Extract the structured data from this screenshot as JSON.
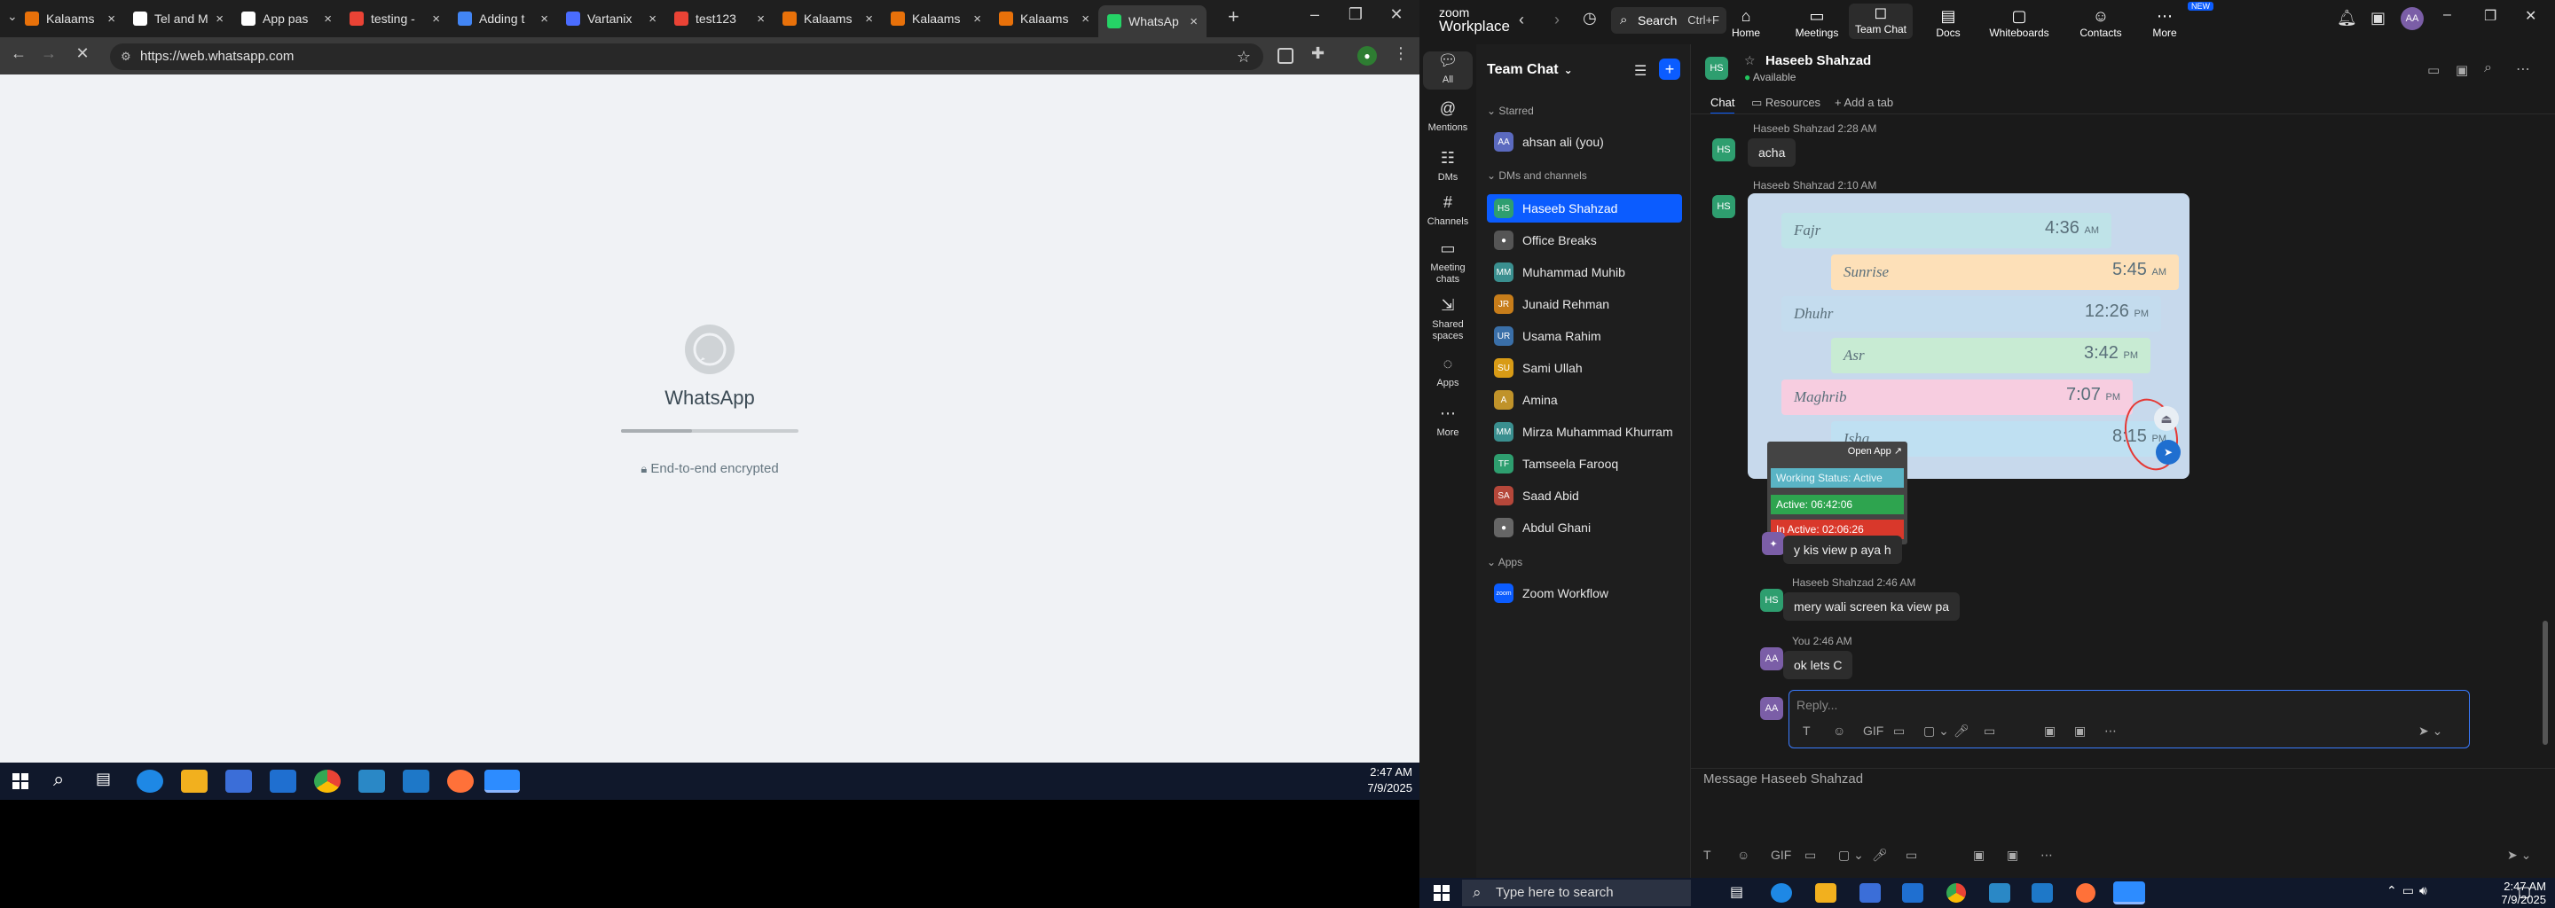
{
  "chrome": {
    "tabs": [
      {
        "label": "Kalaams",
        "color": "#e8710a"
      },
      {
        "label": "Tel and M",
        "color": "#ffffff"
      },
      {
        "label": "App pas",
        "color": "#ffffff"
      },
      {
        "label": "testing -",
        "color": "#ea4335"
      },
      {
        "label": "Adding t",
        "color": "#4285f4"
      },
      {
        "label": "Vartanix",
        "color": "#4a6cff"
      },
      {
        "label": "test123",
        "color": "#ea4335"
      },
      {
        "label": "Kalaams",
        "color": "#e8710a"
      },
      {
        "label": "Kalaams",
        "color": "#e8710a"
      },
      {
        "label": "Kalaams",
        "color": "#e8710a"
      },
      {
        "label": "WhatsAp",
        "color": "#25d366"
      }
    ],
    "url": "https://web.whatsapp.com",
    "page": {
      "title": "WhatsApp",
      "encrypted": "End-to-end encrypted",
      "progress": 0.4
    }
  },
  "taskbar_left": {
    "time": "2:47 AM",
    "date": "7/9/2025"
  },
  "zoom": {
    "logo_top": "zoom",
    "logo_bottom": "Workplace",
    "search": "Search",
    "search_shortcut": "Ctrl+F",
    "nav": [
      "Home",
      "Meetings",
      "Team Chat",
      "Docs",
      "Whiteboards",
      "Contacts",
      "More"
    ],
    "new_badge": "NEW",
    "user_initials": "AA",
    "rail": [
      "All",
      "Mentions",
      "DMs",
      "Channels",
      "Meeting chats",
      "Shared spaces",
      "Apps",
      "More"
    ],
    "list_title": "Team Chat",
    "sections": {
      "starred": "Starred",
      "dms": "DMs and channels",
      "apps": "Apps"
    },
    "starred": [
      {
        "name": "ahsan ali (you)",
        "initials": "AA",
        "color": "#5b6abf"
      }
    ],
    "contacts": [
      {
        "name": "Haseeb Shahzad",
        "initials": "HS",
        "color": "#2e9e6f"
      },
      {
        "name": "Office Breaks",
        "initials": "",
        "color": "#555555"
      },
      {
        "name": "Muhammad Muhib",
        "initials": "MM",
        "color": "#3a8f8f"
      },
      {
        "name": "Junaid Rehman",
        "initials": "JR",
        "color": "#c77d1a"
      },
      {
        "name": "Usama Rahim",
        "initials": "UR",
        "color": "#3a6fa8"
      },
      {
        "name": "Sami Ullah",
        "initials": "SU",
        "color": "#d89b16"
      },
      {
        "name": "Amina",
        "initials": "A",
        "color": "#c0932a"
      },
      {
        "name": "Mirza Muhammad Khurram",
        "initials": "MM",
        "color": "#3a8f8f"
      },
      {
        "name": "Tamseela Farooq",
        "initials": "TF",
        "color": "#2e9e6f"
      },
      {
        "name": "Saad Abid",
        "initials": "SA",
        "color": "#b5473a"
      },
      {
        "name": "Abdul Ghani",
        "initials": "",
        "color": "#666666"
      }
    ],
    "apps": [
      {
        "name": "Zoom Workflow",
        "initials": "zoom",
        "color": "#0b5cff"
      }
    ],
    "chat": {
      "name": "Haseeb Shahzad",
      "status": "Available",
      "tabs": [
        "Chat",
        "Resources",
        "Add a tab"
      ],
      "messages": [
        {
          "sender": "Haseeb Shahzad 2:28 AM",
          "text": "acha"
        },
        {
          "sender": "Haseeb Shahzad 2:10 AM",
          "text": ""
        },
        {
          "sender": "",
          "text": "y kis view p aya h"
        },
        {
          "sender": "Haseeb Shahzad 2:46 AM",
          "text": "mery wali screen ka view pa"
        },
        {
          "sender": "You 2:46 AM",
          "text": "ok lets C"
        }
      ],
      "prayer": [
        {
          "name": "Fajr",
          "time": "4:36",
          "suffix": "AM",
          "color": "#bfe3e8"
        },
        {
          "name": "Sunrise",
          "time": "5:45",
          "suffix": "AM",
          "color": "#fde0b8"
        },
        {
          "name": "Dhuhr",
          "time": "12:26",
          "suffix": "PM",
          "color": "#c4dcee"
        },
        {
          "name": "Asr",
          "time": "3:42",
          "suffix": "PM",
          "color": "#c8ebd3"
        },
        {
          "name": "Maghrib",
          "time": "7:07",
          "suffix": "PM",
          "color": "#f7cde0"
        },
        {
          "name": "Isha",
          "time": "8:15",
          "suffix": "PM",
          "color": "#bfe0f2"
        }
      ],
      "popup": {
        "open_app": "Open App ↗",
        "status": "Working Status: Active",
        "active": "Active: 06:42:06",
        "inactive": "In Active: 02:06:26"
      },
      "reply_placeholder": "Reply...",
      "compose_placeholder": "Message Haseeb Shahzad"
    }
  },
  "taskbar_right": {
    "search": "Type here to search",
    "time": "2:47 AM",
    "date": "7/9/2025"
  }
}
